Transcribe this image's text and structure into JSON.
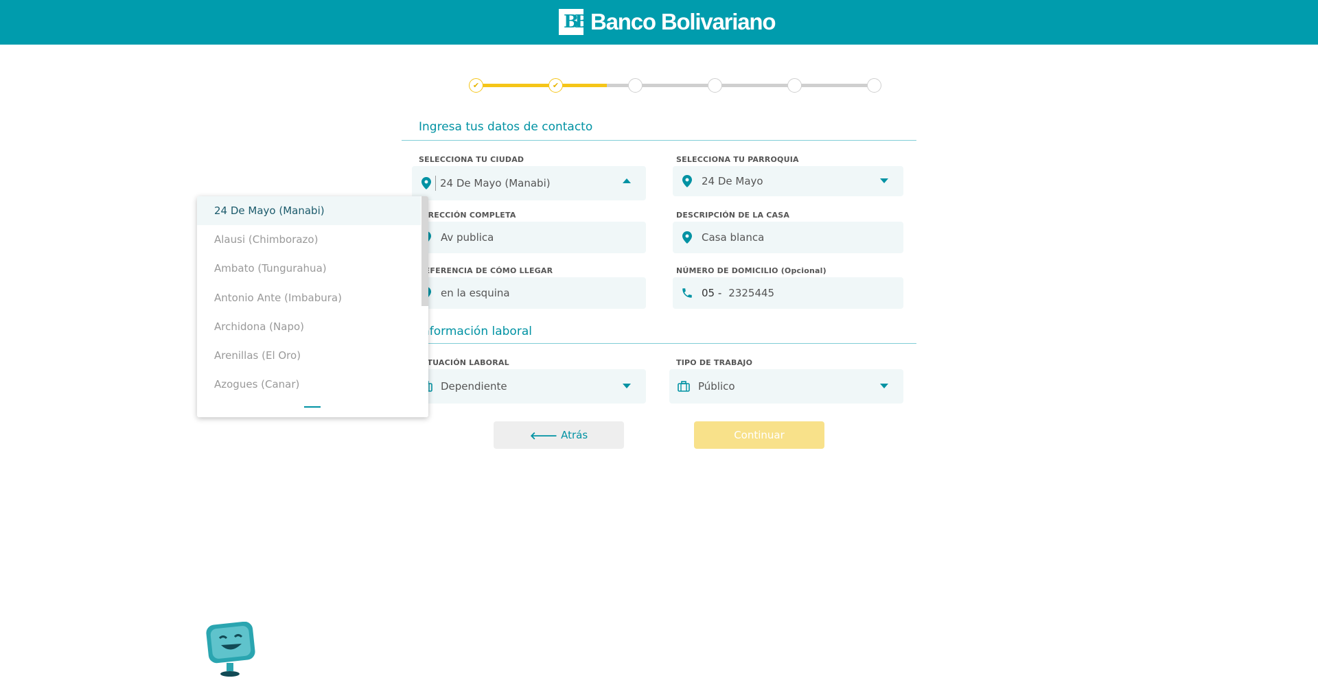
{
  "brand": {
    "name": "Banco Bolivariano",
    "color": "#009cad"
  },
  "stepper": {
    "total_steps": 6,
    "completed_steps": 2,
    "progress": 0.33
  },
  "contact": {
    "title": "Ingresa tus datos de contacto",
    "city": {
      "label": "SELECCIONA TU CIUDAD",
      "value": "24 De Mayo (Manabi)"
    },
    "parish": {
      "label": "SELECCIONA TU PARROQUIA",
      "value": "24 De Mayo"
    },
    "address": {
      "label": "DIRECCIÓN COMPLETA",
      "value": "Av publica"
    },
    "house": {
      "label": "DESCRIPCIÓN DE LA CASA",
      "value": "Casa blanca"
    },
    "reference": {
      "label": "REFERENCIA DE CÓMO LLEGAR",
      "value": "en la esquina"
    },
    "phone": {
      "label": "NÚMERO DE DOMICILIO (Opcional)",
      "prefix": "05 -",
      "value": "2325445"
    }
  },
  "work": {
    "title": "Información laboral",
    "status": {
      "label": "SITUACIÓN LABORAL",
      "value": "Dependiente"
    },
    "type": {
      "label": "TIPO DE TRABAJO",
      "value": "Público"
    }
  },
  "buttons": {
    "back": "Atrás",
    "continue": "Continuar"
  },
  "city_dropdown": {
    "options": [
      "24 De Mayo (Manabi)",
      "Alausi (Chimborazo)",
      "Ambato (Tungurahua)",
      "Antonio Ante (Imbabura)",
      "Archidona (Napo)",
      "Arenillas (El Oro)",
      "Azogues (Canar)"
    ],
    "selected_index": 0
  }
}
